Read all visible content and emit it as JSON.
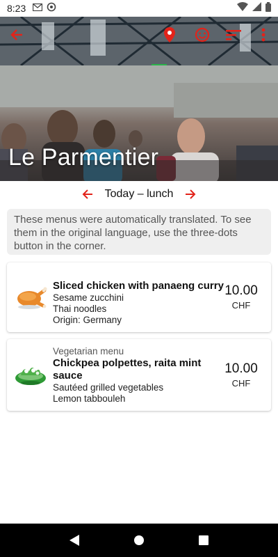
{
  "status_bar": {
    "time": "8:23"
  },
  "restaurant": {
    "name": "Le Parmentier"
  },
  "toolbar": {
    "icons": [
      "back-arrow-icon",
      "map-pin-icon",
      "smiley-icon",
      "sort-icon",
      "more-vertical-icon"
    ],
    "accent_color": "#e2231a"
  },
  "day_nav": {
    "label": "Today – lunch"
  },
  "notice": {
    "text": "These menus were automatically translated. To see them in the original language, use the three-dots button in the corner."
  },
  "menus": [
    {
      "tag": "",
      "name": "Sliced chicken with panaeng curry",
      "lines": [
        "Sesame zucchini",
        "Thai noodles",
        "Origin: Germany"
      ],
      "price": "10.00",
      "currency": "CHF",
      "icon": "roast-chicken-icon"
    },
    {
      "tag": "Vegetarian menu",
      "name": "Chickpea polpettes, raita mint sauce",
      "lines": [
        "Sautéed grilled vegetables",
        "Lemon tabbouleh"
      ],
      "price": "10.00",
      "currency": "CHF",
      "icon": "salad-bowl-icon"
    }
  ]
}
